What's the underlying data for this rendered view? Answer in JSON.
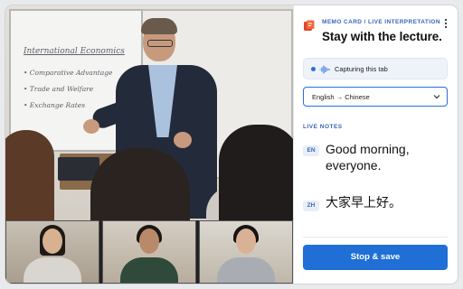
{
  "panel": {
    "eyebrow_left": "MEMO CARD",
    "eyebrow_sep": " / ",
    "eyebrow_right": "LIVE INTERPRETATION",
    "title": "Stay with the lecture.",
    "menu_icon": "kebab-menu-icon",
    "capture_status": "Capturing this tab",
    "language_pair": "English → Chinese",
    "live_notes_label": "LIVE NOTES",
    "notes": [
      {
        "lang": "EN",
        "text": "Good morning, everyone."
      },
      {
        "lang": "ZH",
        "text": "大家早上好。"
      }
    ],
    "action_button": "Stop & save"
  },
  "board": {
    "title": "International Economics",
    "items": [
      "• Comparative Advantage",
      "• Trade and Welfare",
      "• Exchange Rates"
    ]
  },
  "colors": {
    "accent": "#1f6fd6",
    "eyebrow": "#3a67b8",
    "capture_bg": "#eef2f9"
  }
}
